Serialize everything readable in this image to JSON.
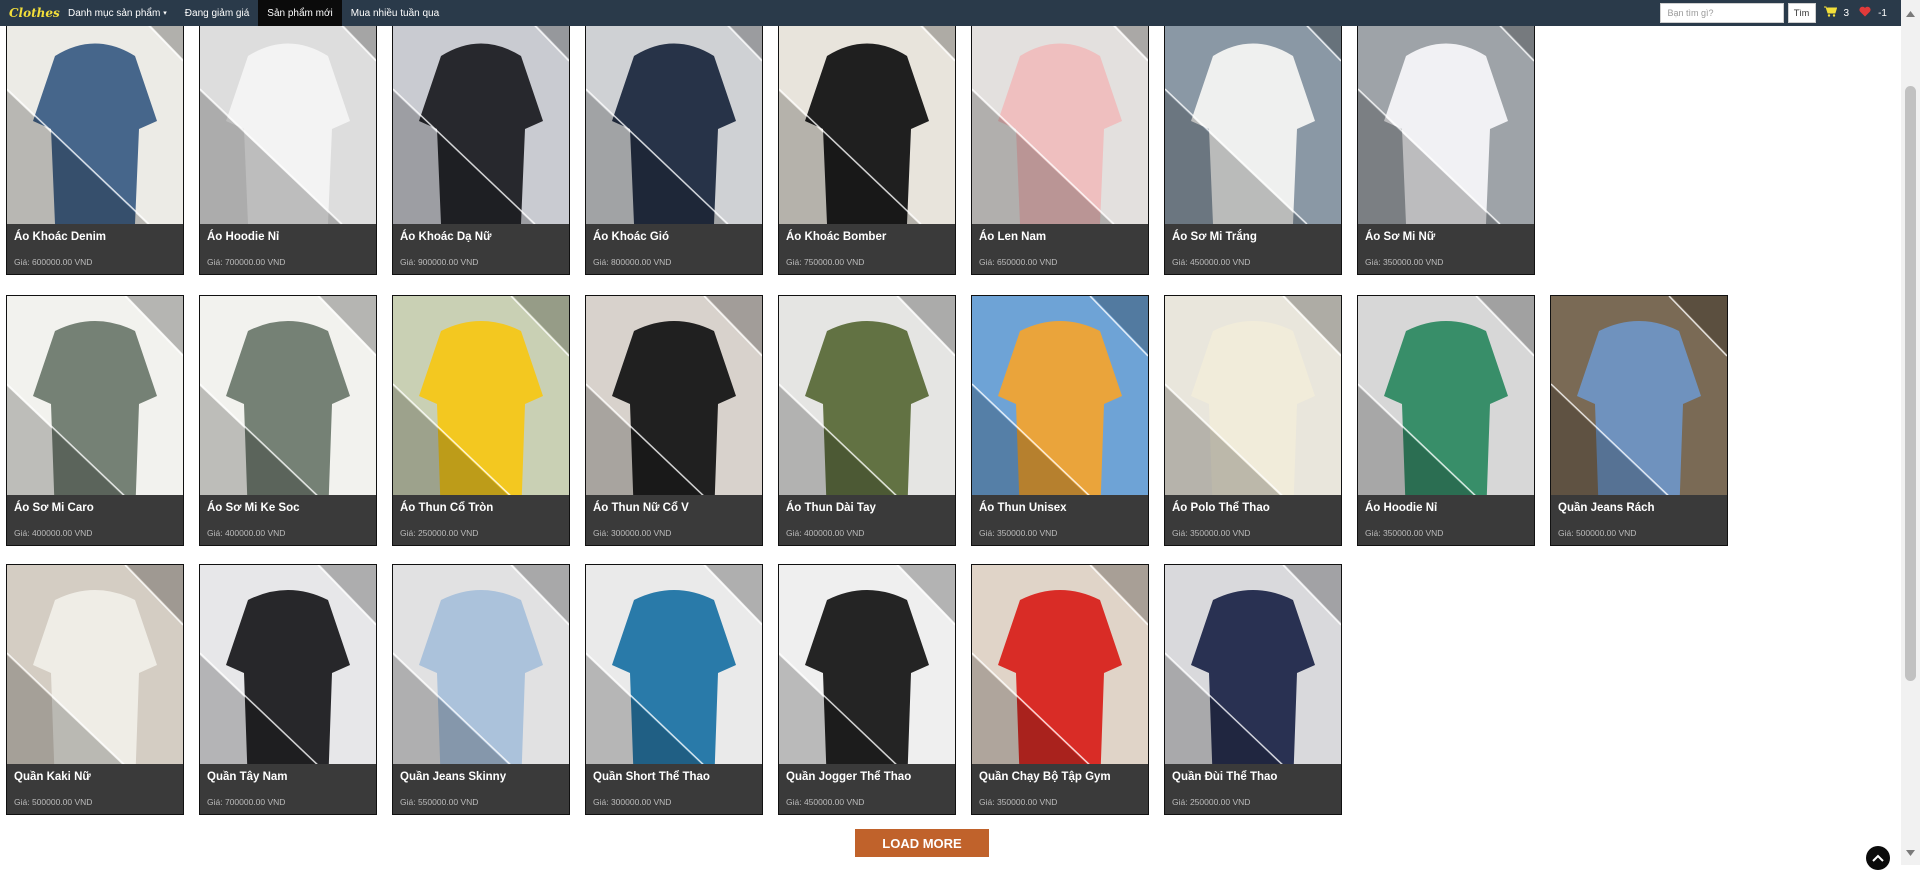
{
  "nav": {
    "brand": "Clothes",
    "menu": [
      {
        "label": "Danh mục sản phẩm",
        "has_dropdown": true,
        "active": false
      },
      {
        "label": "Đang giảm giá",
        "active": false
      },
      {
        "label": "Sản phẩm mới",
        "active": true
      },
      {
        "label": "Mua nhiều tuần qua",
        "active": false
      }
    ],
    "search_placeholder": "Bạn tìm gì?",
    "search_button": "Tìm",
    "cart_count": "3",
    "wishlist_count": "-1",
    "cart_icon": "cart-icon",
    "wishlist_icon": "heart-icon"
  },
  "products": [
    {
      "name": "Áo Khoác Denim",
      "price": "Giá: 600000.00 VND",
      "image": "denim-jacket",
      "color": "#3d5f86",
      "bg": "#ecebe6"
    },
    {
      "name": "Áo Hoodie Nỉ",
      "price": "Giá: 700000.00 VND",
      "image": "white-red-hoodie",
      "color": "#f3f3f3",
      "bg": "#dddddd"
    },
    {
      "name": "Áo Khoác Dạ Nữ",
      "price": "Giá: 900000.00 VND",
      "image": "black-coat-woman",
      "color": "#1f1f24",
      "bg": "#c9cbd1"
    },
    {
      "name": "Áo Khoác Gió",
      "price": "Giá: 800000.00 VND",
      "image": "navy-windbreaker",
      "color": "#1e2a40",
      "bg": "#cfd1d4"
    },
    {
      "name": "Áo Khoác Bomber",
      "price": "Giá: 750000.00 VND",
      "image": "black-bomber",
      "color": "#141414",
      "bg": "#e8e4dc"
    },
    {
      "name": "Áo Len Nam",
      "price": "Giá: 650000.00 VND",
      "image": "pink-sweater",
      "color": "#efbdbd",
      "bg": "#e3e0de"
    },
    {
      "name": "Áo Sơ Mi Trắng",
      "price": "Giá: 450000.00 VND",
      "image": "white-shirt-woman",
      "color": "#f4f4f2",
      "bg": "#8a98a5"
    },
    {
      "name": "Áo Sơ Mi Nữ",
      "price": "Giá: 350000.00 VND",
      "image": "white-shirt-short",
      "color": "#f6f6f8",
      "bg": "#9ea3a8"
    },
    {
      "name": "Áo Sơ Mi Caro",
      "price": "Giá: 400000.00 VND",
      "image": "plaid-shirt",
      "color": "#6e7a6e",
      "bg": "#f2f2ee"
    },
    {
      "name": "Áo Sơ Mi Ke Soc",
      "price": "Giá: 400000.00 VND",
      "image": "plaid-shirt-2",
      "color": "#6e7a6e",
      "bg": "#f2f2ee"
    },
    {
      "name": "Áo Thun Cổ Tròn",
      "price": "Giá: 250000.00 VND",
      "image": "yellow-tshirts",
      "color": "#f5c718",
      "bg": "#c9d0b4"
    },
    {
      "name": "Áo Thun Nữ Cổ V",
      "price": "Giá: 300000.00 VND",
      "image": "black-vneck",
      "color": "#161616",
      "bg": "#d8d2cc"
    },
    {
      "name": "Áo Thun Dài Tay",
      "price": "Giá: 400000.00 VND",
      "image": "olive-longsleeve",
      "color": "#5b6b3a",
      "bg": "#e5e5e3"
    },
    {
      "name": "Áo Thun Unisex",
      "price": "Giá: 350000.00 VND",
      "image": "orange-tee",
      "color": "#f0a433",
      "bg": "#6ea3d6"
    },
    {
      "name": "Áo Polo Thể Thao",
      "price": "Giá: 350000.00 VND",
      "image": "cream-polo",
      "color": "#f1ecd9",
      "bg": "#e9e6dc"
    },
    {
      "name": "Áo Hoodie Nỉ",
      "price": "Giá: 350000.00 VND",
      "image": "green-hoodie",
      "color": "#2f8a63",
      "bg": "#d7d7d7"
    },
    {
      "name": "Quần Jeans Rách",
      "price": "Giá: 500000.00 VND",
      "image": "ripped-jeans",
      "color": "#6f95c4",
      "bg": "#7a6a55"
    },
    {
      "name": "Quần Kaki Nữ",
      "price": "Giá: 500000.00 VND",
      "image": "white-pants",
      "color": "#f0eee8",
      "bg": "#d4cdc3"
    },
    {
      "name": "Quần Tây Nam",
      "price": "Giá: 700000.00 VND",
      "image": "black-trousers",
      "color": "#1c1c20",
      "bg": "#e7e7e9"
    },
    {
      "name": "Quần Jeans Skinny",
      "price": "Giá: 550000.00 VND",
      "image": "light-jeans",
      "color": "#a8c0da",
      "bg": "#e1e1e2"
    },
    {
      "name": "Quần Short Thể Thao",
      "price": "Giá: 300000.00 VND",
      "image": "blue-shorts",
      "color": "#1f74a5",
      "bg": "#eaeaea"
    },
    {
      "name": "Quần Jogger Thể Thao",
      "price": "Giá: 450000.00 VND",
      "image": "joggers",
      "color": "#181818",
      "bg": "#efefef"
    },
    {
      "name": "Quần Chạy Bộ Tập Gym",
      "price": "Giá: 350000.00 VND",
      "image": "red-running-shorts",
      "color": "#d8231d",
      "bg": "#e0d4c8"
    },
    {
      "name": "Quần Đùi Thể Thao",
      "price": "Giá: 250000.00 VND",
      "image": "navy-leggings",
      "color": "#20284a",
      "bg": "#d9d9dc"
    }
  ],
  "load_more": "LOAD MORE"
}
